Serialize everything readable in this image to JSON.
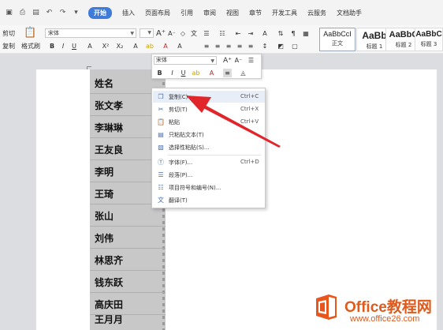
{
  "menubar": {
    "tabs": [
      {
        "label": "开始",
        "active": true
      },
      {
        "label": "插入"
      },
      {
        "label": "页面布局"
      },
      {
        "label": "引用"
      },
      {
        "label": "审阅"
      },
      {
        "label": "视图"
      },
      {
        "label": "章节"
      },
      {
        "label": "开发工具"
      },
      {
        "label": "云服务"
      },
      {
        "label": "文档助手"
      }
    ],
    "accent": "#3f7bd8"
  },
  "ribbon": {
    "cut_label": "剪切",
    "copy_label": "复制",
    "format_painter_label": "格式刷",
    "font_name": "宋体",
    "styles": [
      {
        "sample": "AaBbCcI",
        "name": "正文"
      },
      {
        "sample": "AaBb",
        "name": "标题 1"
      },
      {
        "sample": "AaBbC",
        "name": "标题 2"
      },
      {
        "sample": "AaBbC",
        "name": "标题 3"
      }
    ]
  },
  "table": {
    "rows": [
      "姓名",
      "张文孝",
      "李琳琳",
      "王友良",
      "李明",
      "王琦",
      "张山",
      "刘伟",
      "林思齐",
      "钱东跃",
      "高庆田",
      "王月月"
    ]
  },
  "mini_toolbar": {
    "font_name": "宋体"
  },
  "context_menu": {
    "items": [
      {
        "label": "复制(C)",
        "shortcut": "Ctrl+C",
        "icon": "copy-icon"
      },
      {
        "label": "剪切(T)",
        "shortcut": "Ctrl+X",
        "icon": "scissors-icon"
      },
      {
        "label": "粘贴",
        "shortcut": "Ctrl+V",
        "icon": "paste-icon"
      },
      {
        "label": "只粘贴文本(T)",
        "shortcut": "",
        "icon": "paste-text-icon"
      },
      {
        "label": "选择性粘贴(S)...",
        "shortcut": "",
        "icon": "paste-special-icon"
      },
      {
        "label": "字体(F)...",
        "shortcut": "Ctrl+D",
        "icon": "font-icon"
      },
      {
        "label": "段落(P)...",
        "shortcut": "",
        "icon": "paragraph-icon"
      },
      {
        "label": "项目符号和编号(N)...",
        "shortcut": "",
        "icon": "bullets-icon"
      },
      {
        "label": "翻译(T)",
        "shortcut": "",
        "icon": "translate-icon"
      }
    ]
  },
  "watermark": {
    "title": "Office教程网",
    "url": "www.office26.com",
    "color": "#e05a1b"
  }
}
